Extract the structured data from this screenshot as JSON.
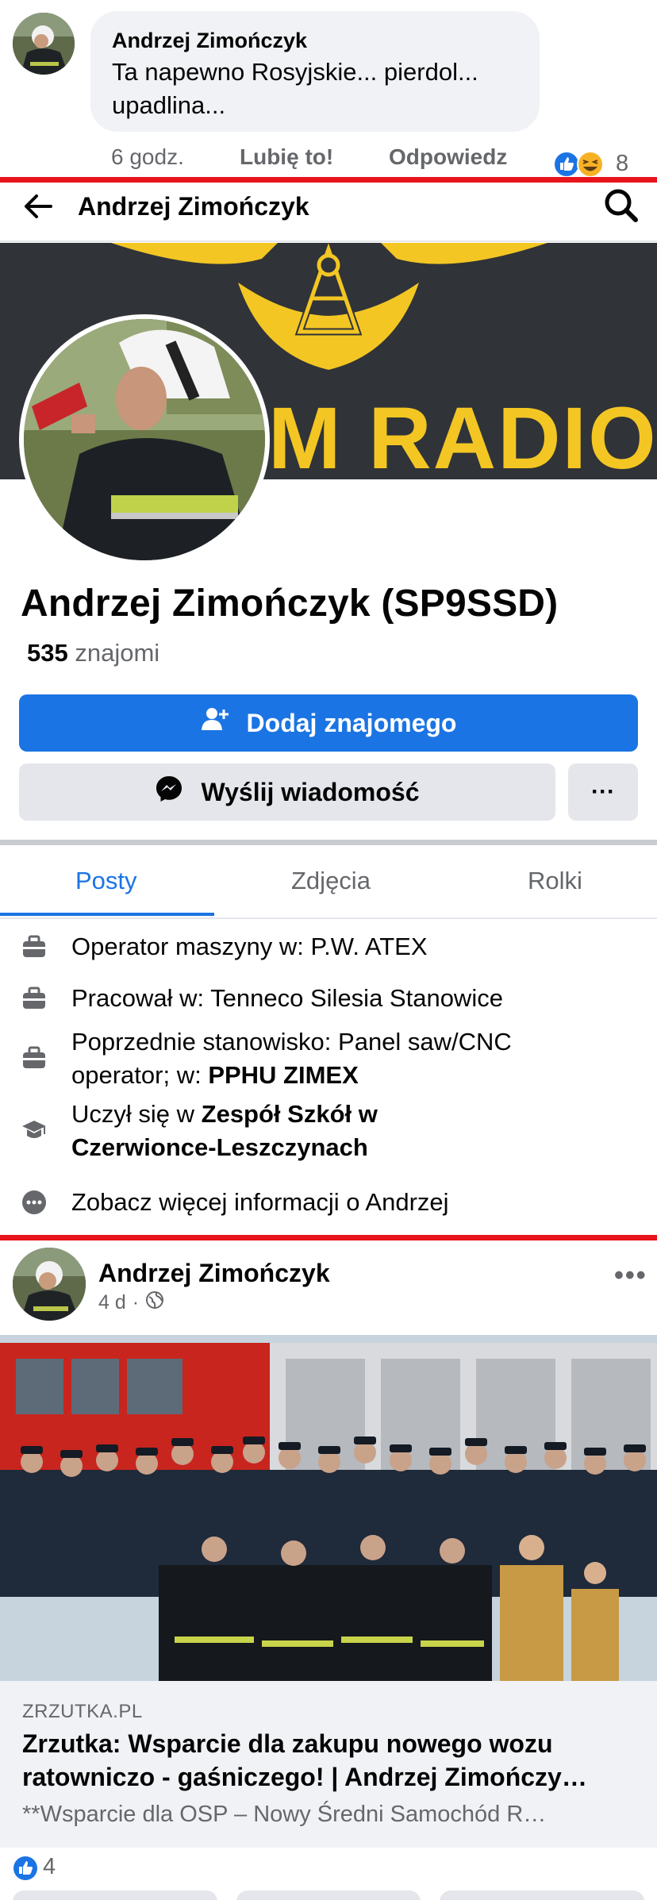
{
  "comment": {
    "author": "Andrzej Zimończyk",
    "text_line1": "Ta napewno Rosyjskie... pierdol...",
    "text_line2": "upadlina...",
    "time": "6 godz.",
    "like_label": "Lubię to!",
    "reply_label": "Odpowiedz",
    "reaction_count": "8",
    "reaction_icons": [
      "like-icon",
      "haha-icon"
    ]
  },
  "profile": {
    "nav_title": "Andrzej Zimończyk",
    "cover_text": "M RADIO",
    "name": "Andrzej Zimończyk (SP9SSD)",
    "friends_count": "535",
    "friends_label": "znajomi",
    "add_friend_label": "Dodaj znajomego",
    "message_label": "Wyślij wiadomość",
    "more_label": "···",
    "tabs": [
      "Posty",
      "Zdjęcia",
      "Rolki"
    ],
    "active_tab": "Posty",
    "info": {
      "job1_prefix": "Operator maszyny w: ",
      "job1_place": "P.W. ATEX",
      "job2_prefix": "Pracował w: ",
      "job2_place": "Tenneco Silesia Stanowice",
      "job3_line1": "Poprzednie stanowisko: Panel saw/CNC",
      "job3_line2_prefix": "operator; w: ",
      "job3_place": "PPHU ZIMEX",
      "school_prefix": "Uczył się w ",
      "school_line1": "Zespół Szkół w",
      "school_line2": "Czerwionce-Leszczynach",
      "more_info": "Zobacz więcej informacji o Andrzej"
    }
  },
  "post": {
    "author": "Andrzej Zimończyk",
    "age": "4 d",
    "separator": "·",
    "more_label": "•••",
    "link_domain": "ZRZUTKA.PL",
    "link_title_line1": "Zrzutka: Wsparcie dla zakupu nowego wozu",
    "link_title_line2": "ratowniczo - gaśniczego! | Andrzej Zimończy…",
    "link_desc": "**Wsparcie dla OSP – Nowy Średni Samochód R…",
    "like_count": "4"
  },
  "colors": {
    "accent": "#1b74e4",
    "separator_red": "#e8141b",
    "secondary_text": "#65676b",
    "bubble_bg": "#f0f2f5",
    "cover_yellow": "#f3c623"
  }
}
